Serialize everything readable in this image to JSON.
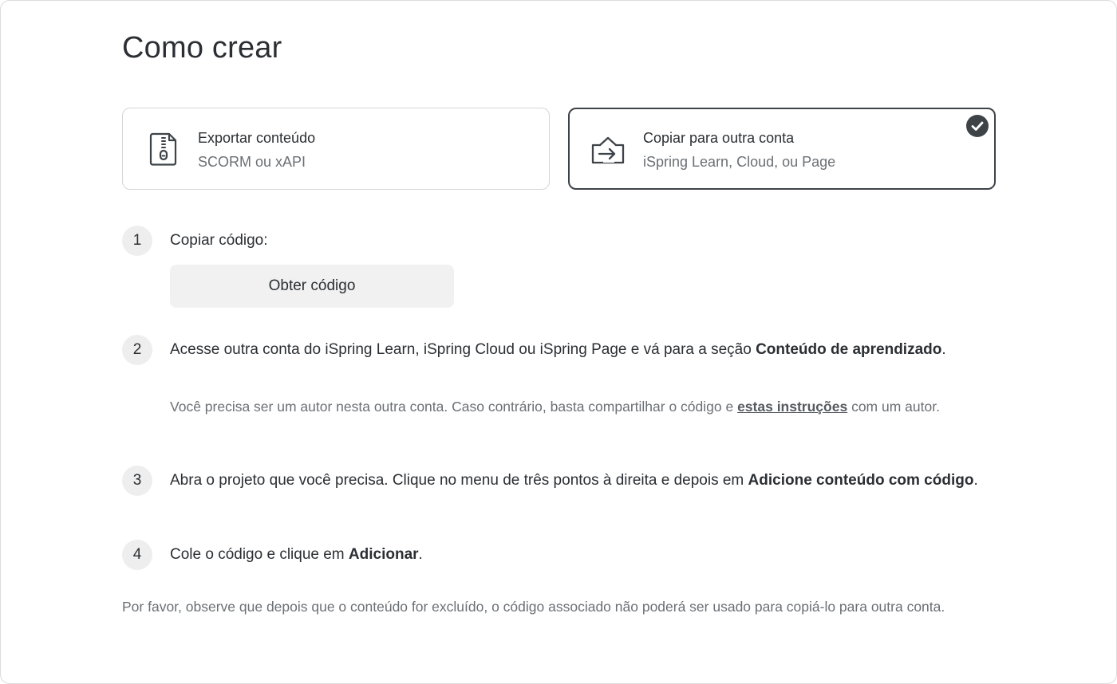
{
  "page": {
    "title": "Como crear"
  },
  "options": [
    {
      "title": "Exportar conteúdo",
      "subtitle": "SCORM ou xAPI",
      "icon": "zip-file-icon",
      "selected": false
    },
    {
      "title": "Copiar para outra conta",
      "subtitle": "iSpring Learn, Cloud, ou Page",
      "icon": "copy-to-account-icon",
      "selected": true
    }
  ],
  "steps": {
    "s1": {
      "num": "1",
      "text": "Copiar código:",
      "button_label": "Obter código"
    },
    "s2": {
      "num": "2",
      "text_before": "Acesse outra conta do iSpring Learn, iSpring Cloud ou iSpring Page e vá para a seção ",
      "bold": "Conteúdo de aprendizado",
      "text_after": ".",
      "note_before": "Você precisa ser um autor nesta outra conta. Caso contrário, basta compartilhar o código e ",
      "note_link": "estas instruções",
      "note_after": " com um autor."
    },
    "s3": {
      "num": "3",
      "text_before": "Abra o projeto que você precisa. Clique no menu de três pontos à direita e depois em ",
      "bold": "Adicione conteúdo com código",
      "text_after": "."
    },
    "s4": {
      "num": "4",
      "text_before": "Cole o código e clique em ",
      "bold": "Adicionar",
      "text_after": "."
    }
  },
  "footer": {
    "note": "Por favor, observe que depois que o conteúdo for excluído, o código associado não poderá ser usado para copiá-lo para outra conta."
  },
  "colors": {
    "text": "#2b2f33",
    "muted": "#6b7075",
    "selected_border": "#3e4348",
    "border": "#d3d5d8",
    "step_bg": "#eeeeee",
    "button_bg": "#f1f1f1"
  }
}
